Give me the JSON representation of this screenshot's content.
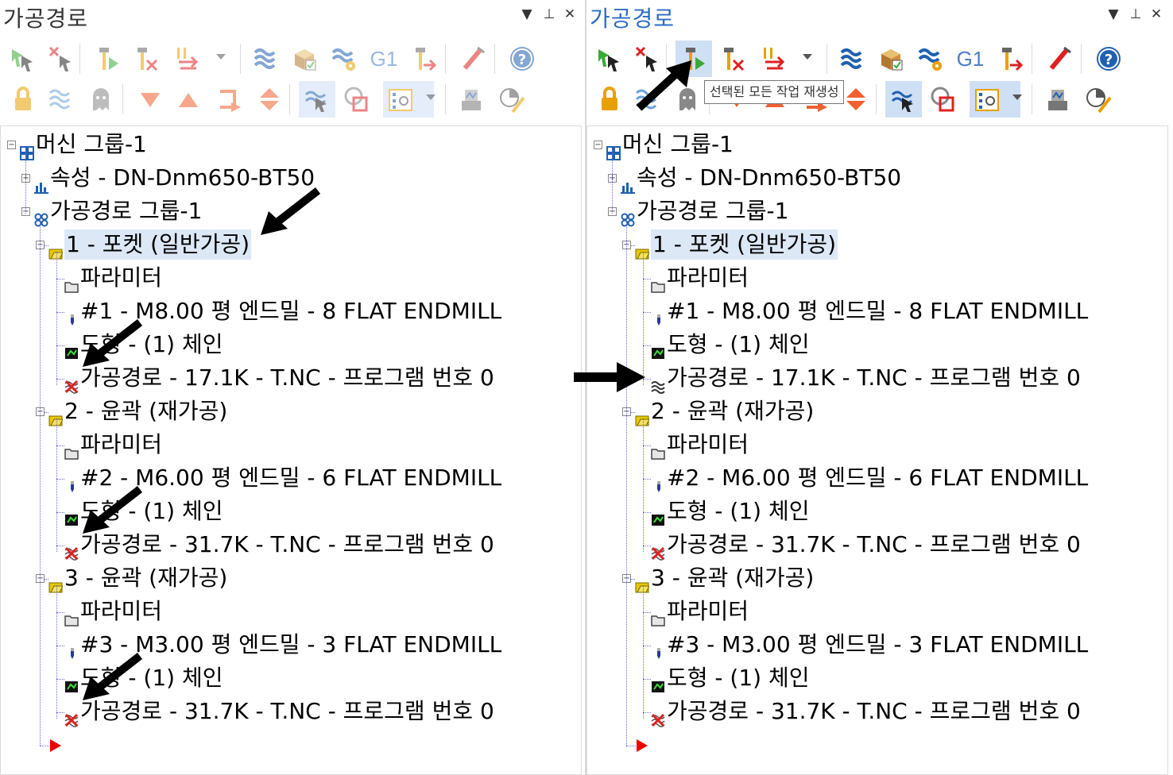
{
  "panel_title": "가공경로",
  "window_controls": {
    "menu": "▾",
    "pin": "ᵖ",
    "close": "✕"
  },
  "tooltip": "선택된 모든 작업 재생성",
  "toolbar_row1_icons": [
    "select-all-icon",
    "deselect-icon",
    "regenerate-all-icon",
    "regenerate-dirty-icon",
    "move-ops-icon",
    "toolpath-display-icon",
    "verify-icon",
    "simulate-icon",
    "g1-post-icon",
    "post-selected-icon",
    "highlight-toolpath-icon",
    "help-icon"
  ],
  "toolbar_row2_icons": [
    "lock-icon",
    "wave-icon",
    "ghost-icon",
    "move-down-icon",
    "move-up-icon",
    "insert-arrow-icon",
    "expand-collapse-icon",
    "display-toolpath-icon",
    "stock-icon",
    "filter-icon",
    "machine-settings-icon",
    "edit-chart-icon"
  ],
  "g1_label": "G1",
  "tree": {
    "machine_group": "머신 그룹-1",
    "properties": "속성 - DN-Dnm650-BT50",
    "toolpath_group": "가공경로 그룹-1",
    "operations": [
      {
        "title": "1 - 포켓 (일반가공)",
        "params": "파라미터",
        "tool": "#1 - M8.00 평 엔드밀 - 8 FLAT ENDMILL",
        "geometry": "도형 - (1) 체인",
        "toolpath": "가공경로 - 17.1K - T.NC - 프로그램 번호 0"
      },
      {
        "title": "2 - 윤곽 (재가공)",
        "params": "파라미터",
        "tool": "#2 - M6.00 평 엔드밀 - 6 FLAT ENDMILL",
        "geometry": "도형 - (1) 체인",
        "toolpath": "가공경로 - 31.7K - T.NC - 프로그램 번호 0"
      },
      {
        "title": "3 - 윤곽 (재가공)",
        "params": "파라미터",
        "tool": "#3 - M3.00 평 엔드밀 - 3 FLAT ENDMILL",
        "geometry": "도형 - (1) 체인",
        "toolpath": "가공경로 - 31.7K - T.NC - 프로그램 번호 0"
      }
    ]
  },
  "status_colors": {
    "dirty": "#e02020",
    "ok_toolpath": "#2a2a2a",
    "folder": "#e8c800",
    "highlight": "#dde8f6"
  }
}
